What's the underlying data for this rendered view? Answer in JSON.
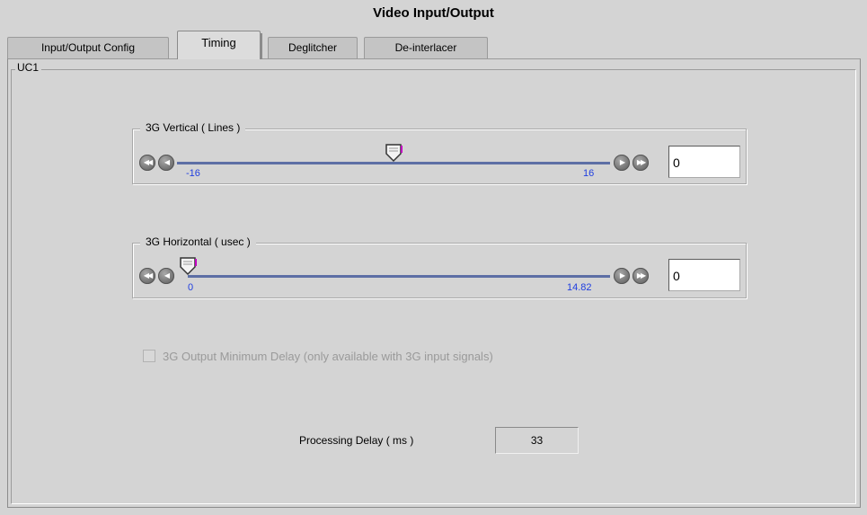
{
  "window": {
    "title": "Video Input/Output"
  },
  "tabs": [
    {
      "label": "Input/Output Config",
      "active": false
    },
    {
      "label": "Timing",
      "active": true
    },
    {
      "label": "Deglitcher",
      "active": false
    },
    {
      "label": "De-interlacer",
      "active": false
    }
  ],
  "panel": {
    "group_label": "UC1"
  },
  "vertical": {
    "label": "3G Vertical ( Lines )",
    "min_label": "-16",
    "max_label": "16",
    "min": -16,
    "max": 16,
    "value": 0,
    "input_value": "0"
  },
  "horizontal": {
    "label": "3G Horizontal ( usec )",
    "min_label": "0",
    "max_label": "14.82",
    "min": 0,
    "max": 14.82,
    "value": 0,
    "input_value": "0"
  },
  "min_delay": {
    "label": "3G Output Minimum Delay (only available with 3G input signals)",
    "checked": false,
    "enabled": false
  },
  "processing_delay": {
    "label": "Processing Delay ( ms )",
    "value": "33"
  },
  "colors": {
    "track": "#5d6fa5",
    "tick_text": "#1f3ee0",
    "thumb_accent": "#c000c0"
  }
}
